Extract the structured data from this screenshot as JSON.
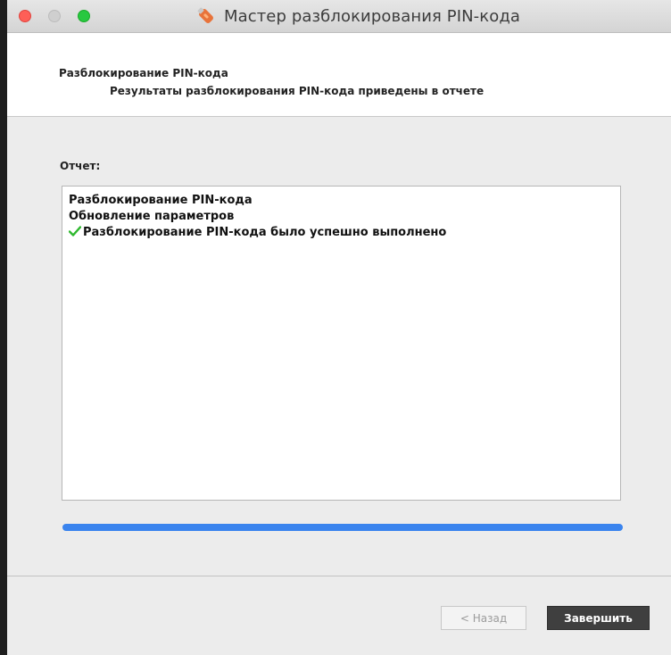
{
  "window": {
    "title": "Мастер разблокирования PIN-кода",
    "title_icon": "usb-token-icon"
  },
  "header": {
    "title": "Разблокирование PIN-кода",
    "subtitle": "Результаты разблокирования PIN-кода приведены в отчете"
  },
  "report": {
    "label": "Отчет:",
    "lines": [
      {
        "text": "Разблокирование PIN-кода",
        "icon": null
      },
      {
        "text": "Обновление параметров",
        "icon": null
      },
      {
        "text": "Разблокирование PIN-кода было успешно выполнено",
        "icon": "check-icon"
      }
    ]
  },
  "progress": {
    "value_percent": 100,
    "color": "#3a84ee"
  },
  "buttons": {
    "back_label": "< Назад",
    "finish_label": "Завершить"
  },
  "colors": {
    "close": "#fe5f57",
    "maximize": "#28c840",
    "check": "#2eb82e",
    "primary_button": "#3f3f3f"
  }
}
